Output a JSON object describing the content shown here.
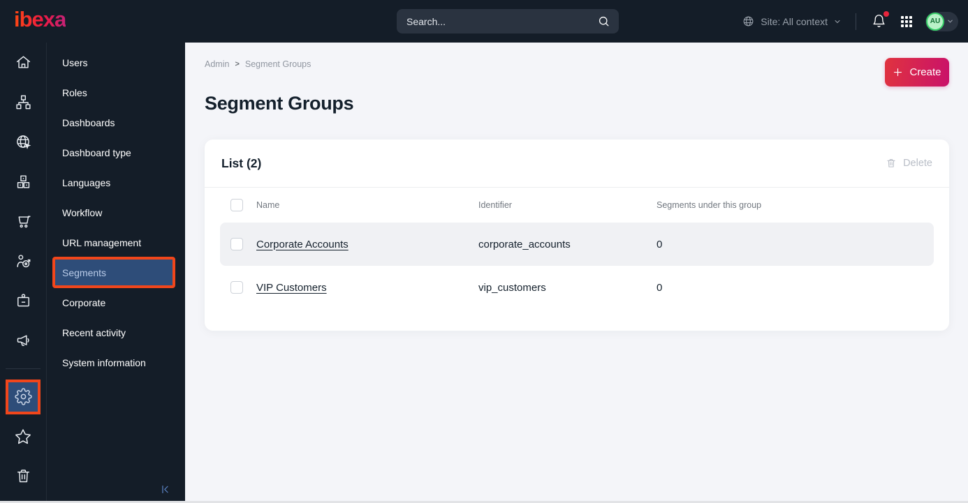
{
  "topbar": {
    "logo": "ibexa",
    "search_placeholder": "Search...",
    "site_context": "Site: All context",
    "avatar_initials": "AU"
  },
  "icon_rail": {
    "items": [
      "home",
      "content-tree",
      "site",
      "product-catalog",
      "commerce",
      "personalization",
      "subscriptions",
      "marketing",
      "settings",
      "bookmarks",
      "trash"
    ],
    "active_item": "settings",
    "highlight_color": "#f1461b",
    "active_bg_color": "#2e4d79"
  },
  "sidebar": {
    "items": [
      {
        "label": "Users",
        "active": false
      },
      {
        "label": "Roles",
        "active": false
      },
      {
        "label": "Dashboards",
        "active": false
      },
      {
        "label": "Dashboard type",
        "active": false
      },
      {
        "label": "Languages",
        "active": false
      },
      {
        "label": "Workflow",
        "active": false
      },
      {
        "label": "URL management",
        "active": false
      },
      {
        "label": "Segments",
        "active": true
      },
      {
        "label": "Corporate",
        "active": false
      },
      {
        "label": "Recent activity",
        "active": false
      },
      {
        "label": "System information",
        "active": false
      }
    ]
  },
  "main": {
    "breadcrumb": [
      "Admin",
      "Segment Groups"
    ],
    "breadcrumb_separator": ">",
    "page_title": "Segment Groups",
    "create_label": "Create",
    "card": {
      "title": "List (2)",
      "delete_label": "Delete",
      "columns": [
        "Name",
        "Identifier",
        "Segments under this group"
      ],
      "rows": [
        {
          "name": "Corporate Accounts",
          "identifier": "corporate_accounts",
          "segments": "0",
          "highlighted": true
        },
        {
          "name": "VIP Customers",
          "identifier": "vip_customers",
          "segments": "0",
          "highlighted": false
        }
      ]
    }
  },
  "colors": {
    "topbar_bg": "#141d28",
    "accent_pink": "#c9116a",
    "accent_orange_annotation": "#f1461b",
    "active_blue": "#2e4d79",
    "notification_red": "#e8253c",
    "avatar_green": "#b9f2c8",
    "main_bg": "#f4f5f9",
    "row_highlight": "#f0f1f4"
  }
}
